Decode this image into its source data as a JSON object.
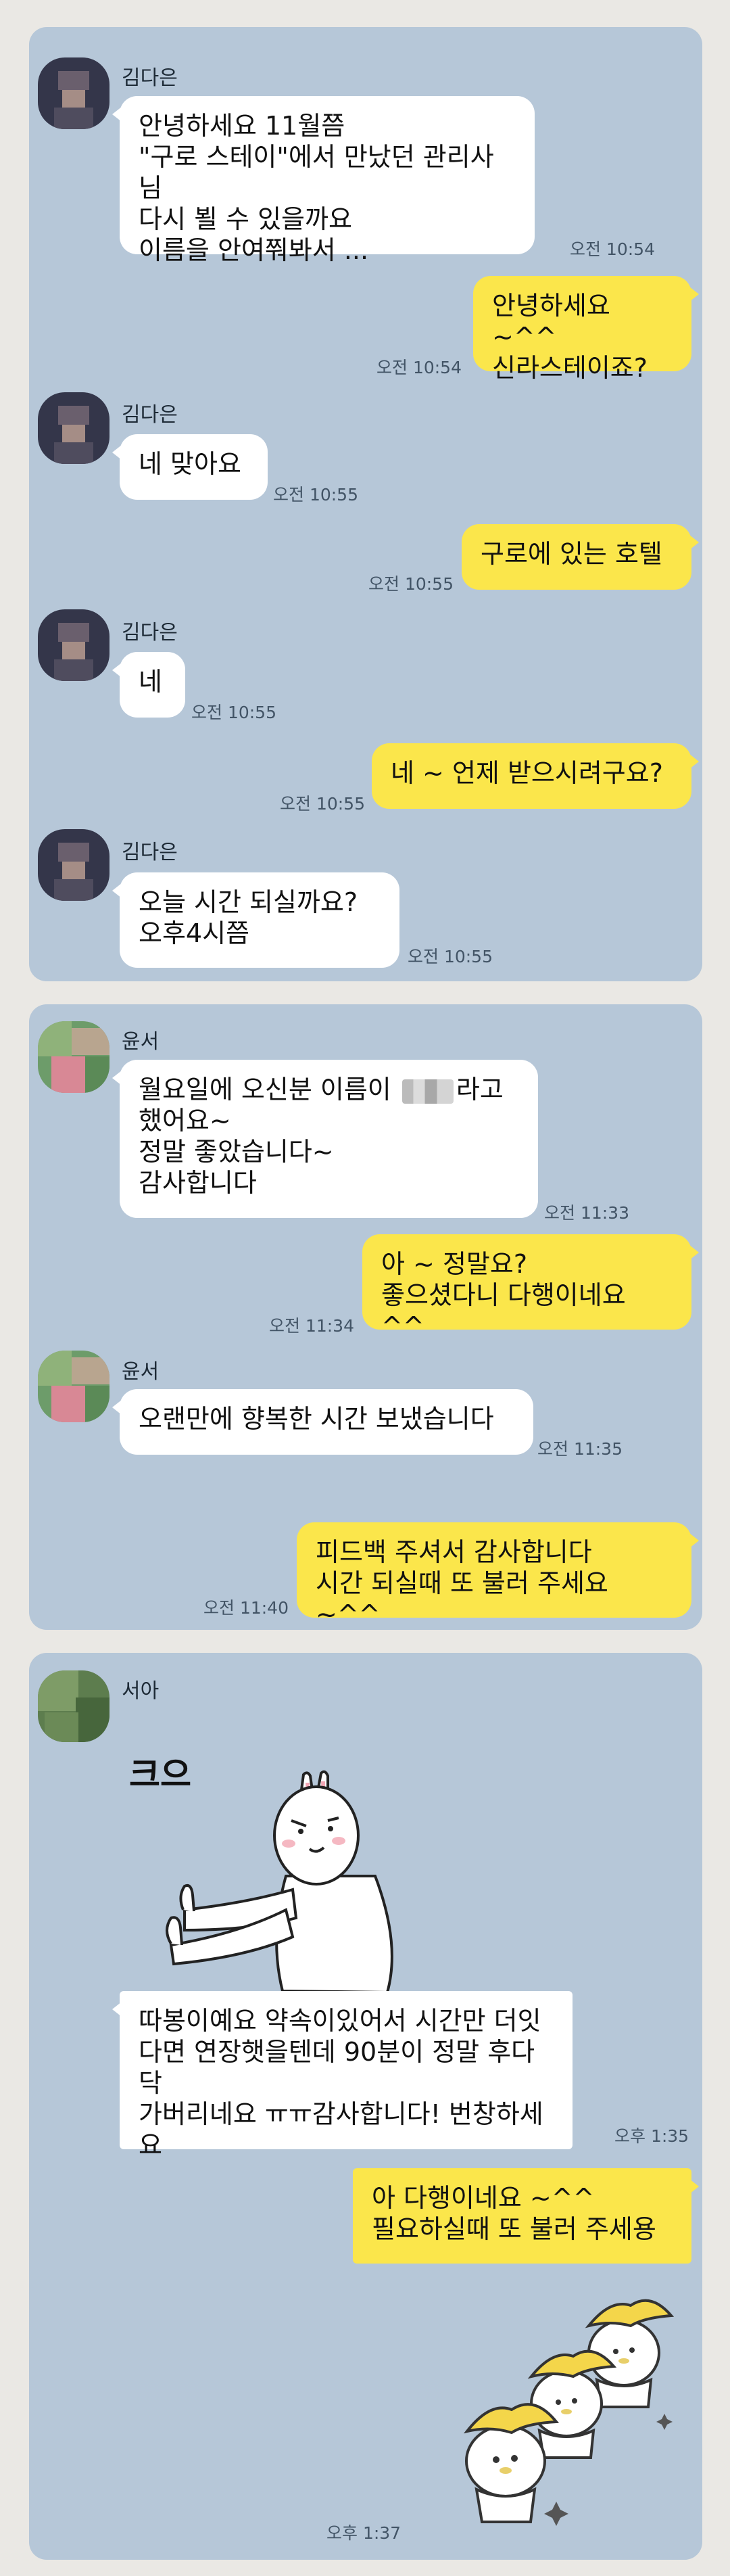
{
  "chat1": {
    "messages": [
      {
        "sender": "김다은",
        "text": "안녕하세요 11월쯤\n\"구로 스테이\"에서 만났던 관리사님\n다시 뵐 수 있을까요\n이름을 안여쭤봐서 ...",
        "time": "오전 10:54"
      },
      {
        "text": "안녕하세요 ~^^\n신라스테이죠?",
        "time": "오전 10:54"
      },
      {
        "sender": "김다은",
        "text": "네 맞아요",
        "time": "오전 10:55"
      },
      {
        "text": "구로에 있는 호텔",
        "time": "오전 10:55"
      },
      {
        "sender": "김다은",
        "text": "네",
        "time": "오전 10:55"
      },
      {
        "text": "네 ~ 언제 받으시려구요?",
        "time": "오전 10:55"
      },
      {
        "sender": "김다은",
        "text": "오늘  시간 되실까요?\n오후4시쯤",
        "time": "오전 10:55"
      }
    ]
  },
  "chat2": {
    "messages": [
      {
        "sender": "윤서",
        "line1_a": "월요일에 오신분 이름이",
        "line1_b": "라고",
        "rest": "했어요~\n정말 좋았습니다~\n감사합니다",
        "time": "오전 11:33"
      },
      {
        "text": "아 ~ 정말요?\n좋으셨다니 다행이네요 ^^",
        "time": "오전 11:34"
      },
      {
        "sender": "윤서",
        "text": "오랜만에 향복한 시간 보냈습니다",
        "time": "오전 11:35"
      },
      {
        "text": "피드백 주셔서 감사합니다\n시간 되실때 또 불러 주세요 ~^^",
        "time": "오전 11:40"
      }
    ]
  },
  "chat3": {
    "messages": [
      {
        "sender": "서아",
        "sticker_text": "크으",
        "text": "따봉이예요 약속이있어서 시간만 더잇\n다면 연장햇을텐데 90분이 정말 후다닥\n가버리네요 ㅠㅠ감사합니다! 번창하세\n요",
        "time": "오후 1:35"
      },
      {
        "text": "아 다행이네요 ~^^\n필요하실때 또 불러 주세용",
        "time": "오후 1:37"
      }
    ]
  },
  "colors": {
    "background": "#eae8e4",
    "chat_background": "#b6c7d8",
    "incoming_bubble": "#ffffff",
    "outgoing_bubble": "#fbe64b"
  }
}
